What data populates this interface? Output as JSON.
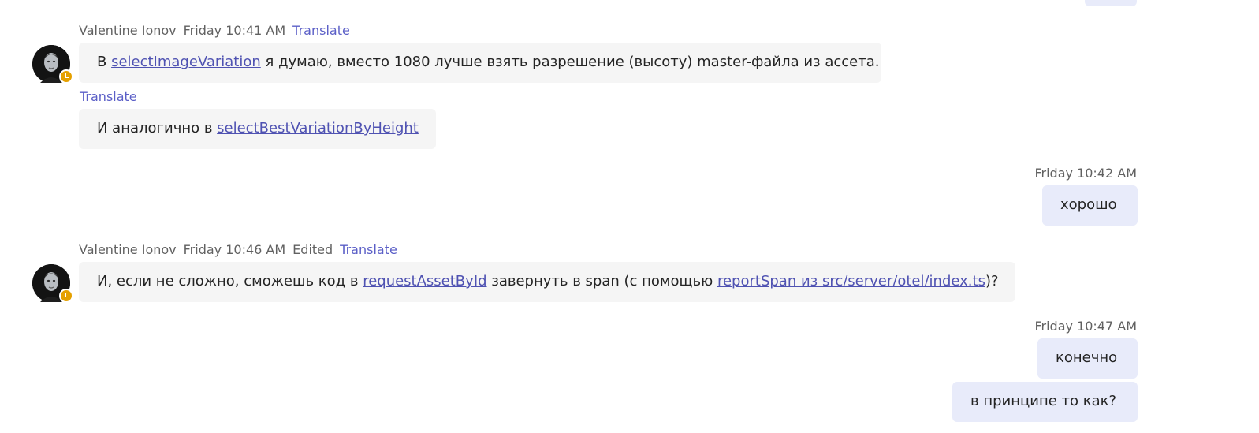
{
  "colors": {
    "incoming_bubble": "#f5f5f5",
    "outgoing_bubble": "#e8ebfa",
    "link": "#4f52b2",
    "translate_link": "#5b5fc7",
    "status_away": "#e5a000"
  },
  "messages": [
    {
      "author": "Valentine Ionov",
      "time": "Friday 10:41 AM",
      "translate": "Translate",
      "parts": [
        {
          "text": "В "
        },
        {
          "link": "selectImageVariation"
        },
        {
          "text": " я думаю, вместо 1080 лучше взять разрешение (высоту) master-файла из ассета."
        }
      ],
      "avatar_icon": "user-avatar",
      "status_icon": "away-clock-icon"
    },
    {
      "translate": "Translate",
      "parts": [
        {
          "text": "И аналогично в "
        },
        {
          "link": "selectBestVariationByHeight"
        }
      ]
    },
    {
      "time": "Friday 10:42 AM",
      "text": "хорошо"
    },
    {
      "author": "Valentine Ionov",
      "time": "Friday 10:46 AM",
      "edited": "Edited",
      "translate": "Translate",
      "parts": [
        {
          "text": "И, если не сложно, сможешь код в "
        },
        {
          "link": "requestAssetById"
        },
        {
          "text": " завернуть в span (с помощью "
        },
        {
          "link": "reportSpan из src/server/otel/index.ts"
        },
        {
          "text": ")?"
        }
      ],
      "avatar_icon": "user-avatar",
      "status_icon": "away-clock-icon"
    },
    {
      "time": "Friday 10:47 AM",
      "text": "конечно"
    },
    {
      "text": "в принципе то как?"
    }
  ]
}
